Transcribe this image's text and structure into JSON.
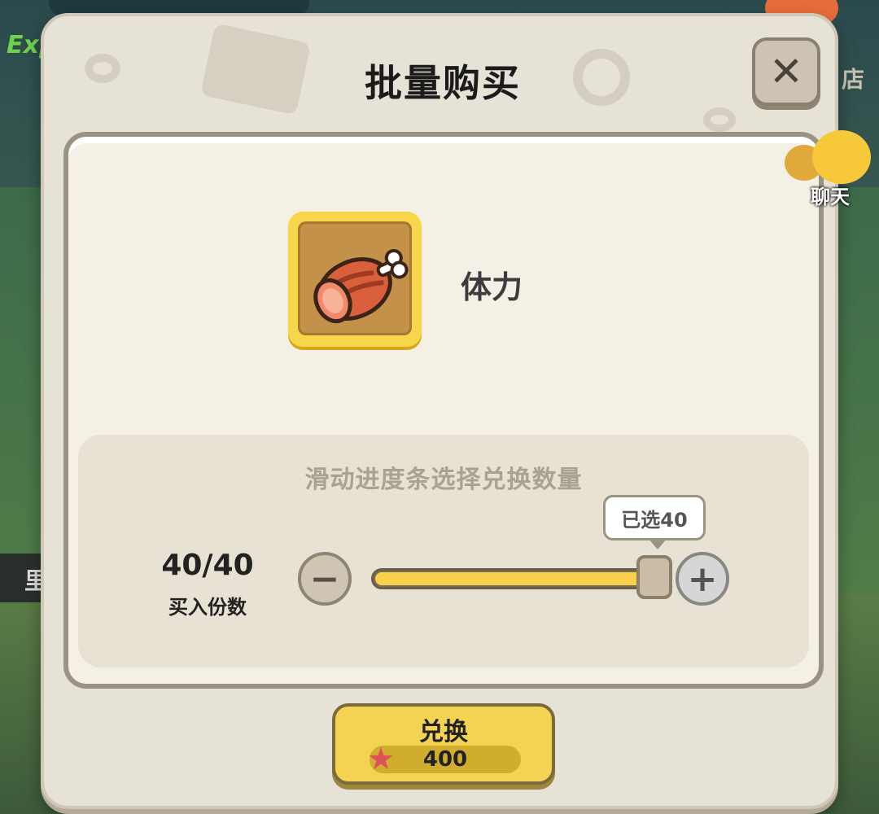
{
  "background": {
    "side_label": "店",
    "exp_label": "Exp",
    "left_label": "里"
  },
  "dialog": {
    "title": "批量购买",
    "close_symbol": "✕"
  },
  "item": {
    "name": "体力",
    "icon": "meat-icon"
  },
  "slider": {
    "hint": "滑动进度条选择兑换数量",
    "count_display": "40/40",
    "count_label": "买入份数",
    "tooltip": "已选40",
    "selected": 40,
    "max": 40,
    "minus_symbol": "−",
    "plus_symbol": "+"
  },
  "exchange": {
    "label": "兑换",
    "price": "400",
    "currency_icon": "starfish-icon"
  },
  "chat": {
    "label": "聊天"
  }
}
